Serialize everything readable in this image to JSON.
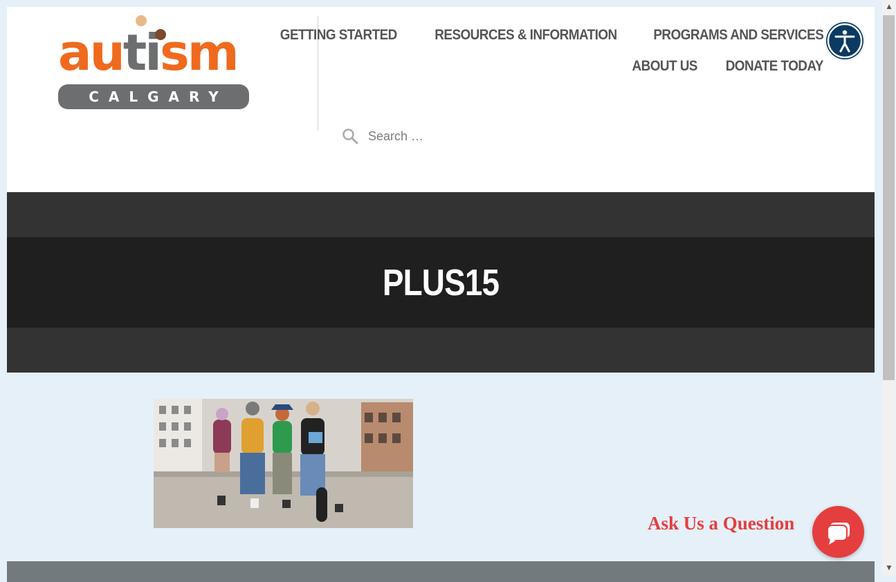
{
  "logo": {
    "word_part1": "au",
    "word_part2": "t",
    "word_part3": "i",
    "word_part4": "sm",
    "subtitle": "CALGARY",
    "colors": {
      "orange": "#ef6a1e",
      "gray": "#6d6e70",
      "dot_tan": "#e8b98a",
      "dot_brown": "#7a4a2a"
    }
  },
  "nav": {
    "row1": [
      "GETTING STARTED",
      "RESOURCES & INFORMATION",
      "PROGRAMS AND SERVICES"
    ],
    "row2": [
      "ABOUT US",
      "DONATE TODAY"
    ]
  },
  "accessibility": {
    "icon": "accessibility-person-icon",
    "color": "#0b3a62"
  },
  "search": {
    "placeholder": "Search …",
    "icon": "search-icon"
  },
  "banner": {
    "title": "PLUS15",
    "colors": {
      "outer": "#333333",
      "inner": "#1f1f1f"
    }
  },
  "content": {
    "image_subject": "group-of-young-people-on-wall-photo"
  },
  "chat": {
    "label": "Ask Us a Question",
    "icon": "chat-bubble-icon",
    "color": "#e53e3e"
  },
  "footer": {
    "color": "#737a7e"
  }
}
